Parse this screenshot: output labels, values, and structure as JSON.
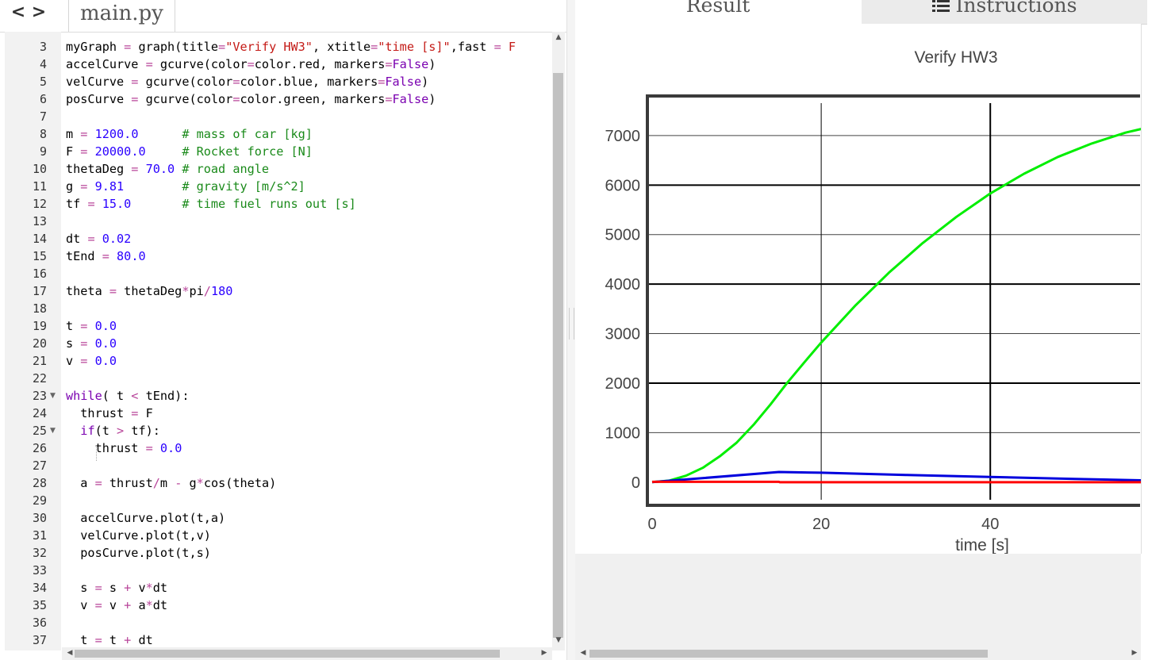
{
  "editor": {
    "filename": "main.py",
    "nav_back": "<",
    "nav_forward": ">",
    "lines": [
      {
        "no": "3",
        "fold": false,
        "html": "myGraph <span class='o'>=</span> graph(title<span class='o'>=</span><span class='s'>\"Verify HW3\"</span>, xtitle<span class='o'>=</span><span class='s'>\"time [s]\"</span>,fast <span class='o'>=</span> <span class='s'>F</span>"
      },
      {
        "no": "4",
        "fold": false,
        "html": "accelCurve <span class='o'>=</span> gcurve(color<span class='o'>=</span>color.red, markers<span class='o'>=</span><span class='k'>False</span>)"
      },
      {
        "no": "5",
        "fold": false,
        "html": "velCurve <span class='o'>=</span> gcurve(color<span class='o'>=</span>color.blue, markers<span class='o'>=</span><span class='k'>False</span>)"
      },
      {
        "no": "6",
        "fold": false,
        "html": "posCurve <span class='o'>=</span> gcurve(color<span class='o'>=</span>color.green, markers<span class='o'>=</span><span class='k'>False</span>)"
      },
      {
        "no": "7",
        "fold": false,
        "html": ""
      },
      {
        "no": "8",
        "fold": false,
        "html": "m <span class='o'>=</span> <span class='n'>1200.0</span>      <span class='c'># mass of car [kg]</span>"
      },
      {
        "no": "9",
        "fold": false,
        "html": "F <span class='o'>=</span> <span class='n'>20000.0</span>     <span class='c'># Rocket force [N]</span>"
      },
      {
        "no": "10",
        "fold": false,
        "html": "thetaDeg <span class='o'>=</span> <span class='n'>70.0</span> <span class='c'># road angle</span>"
      },
      {
        "no": "11",
        "fold": false,
        "html": "g <span class='o'>=</span> <span class='n'>9.81</span>        <span class='c'># gravity [m/s^2]</span>"
      },
      {
        "no": "12",
        "fold": false,
        "html": "tf <span class='o'>=</span> <span class='n'>15.0</span>       <span class='c'># time fuel runs out [s]</span>"
      },
      {
        "no": "13",
        "fold": false,
        "html": ""
      },
      {
        "no": "14",
        "fold": false,
        "html": "dt <span class='o'>=</span> <span class='n'>0.02</span>"
      },
      {
        "no": "15",
        "fold": false,
        "html": "tEnd <span class='o'>=</span> <span class='n'>80.0</span>"
      },
      {
        "no": "16",
        "fold": false,
        "html": ""
      },
      {
        "no": "17",
        "fold": false,
        "html": "theta <span class='o'>=</span> thetaDeg<span class='o'>*</span>pi<span class='o'>/</span><span class='n'>180</span>"
      },
      {
        "no": "18",
        "fold": false,
        "html": ""
      },
      {
        "no": "19",
        "fold": false,
        "html": "t <span class='o'>=</span> <span class='n'>0.0</span>"
      },
      {
        "no": "20",
        "fold": false,
        "html": "s <span class='o'>=</span> <span class='n'>0.0</span>"
      },
      {
        "no": "21",
        "fold": false,
        "html": "v <span class='o'>=</span> <span class='n'>0.0</span>"
      },
      {
        "no": "22",
        "fold": false,
        "html": ""
      },
      {
        "no": "23",
        "fold": true,
        "html": "<span class='k'>while</span>( t <span class='o'>&lt;</span> tEnd):"
      },
      {
        "no": "24",
        "fold": false,
        "html": "  thrust <span class='o'>=</span> F"
      },
      {
        "no": "25",
        "fold": true,
        "html": "  <span class='k'>if</span>(t <span class='o'>&gt;</span> tf):"
      },
      {
        "no": "26",
        "fold": false,
        "html": "    thrust <span class='o'>=</span> <span class='n'>0.0</span>"
      },
      {
        "no": "27",
        "fold": false,
        "html": ""
      },
      {
        "no": "28",
        "fold": false,
        "html": "  a <span class='o'>=</span> thrust<span class='o'>/</span>m <span class='o'>-</span> g<span class='o'>*</span>cos(theta)"
      },
      {
        "no": "29",
        "fold": false,
        "html": ""
      },
      {
        "no": "30",
        "fold": false,
        "html": "  accelCurve.plot(t,a)"
      },
      {
        "no": "31",
        "fold": false,
        "html": "  velCurve.plot(t,v)"
      },
      {
        "no": "32",
        "fold": false,
        "html": "  posCurve.plot(t,s)"
      },
      {
        "no": "33",
        "fold": false,
        "html": ""
      },
      {
        "no": "34",
        "fold": false,
        "html": "  s <span class='o'>=</span> s <span class='o'>+</span> v<span class='o'>*</span>dt"
      },
      {
        "no": "35",
        "fold": false,
        "html": "  v <span class='o'>=</span> v <span class='o'>+</span> a<span class='o'>*</span>dt"
      },
      {
        "no": "36",
        "fold": false,
        "html": ""
      },
      {
        "no": "37",
        "fold": false,
        "html": "  t <span class='o'>=</span> t <span class='o'>+</span> dt"
      }
    ]
  },
  "tabs": {
    "result": "Result",
    "instructions": "Instructions",
    "instructions_icon": "list-icon"
  },
  "colors": {
    "accel": "#ff0000",
    "vel": "#0000dd",
    "pos": "#00ee00",
    "keyword": "#7a00b0",
    "string": "#c41a16",
    "number": "#2a00ff",
    "comment": "#1a8a1a"
  },
  "chart_data": {
    "type": "line",
    "title": "Verify HW3",
    "xlabel": "time [s]",
    "ylabel": "",
    "xlim": [
      0,
      59.5
    ],
    "ylim": [
      -420,
      7800
    ],
    "x_ticks": [
      0,
      20,
      40,
      60
    ],
    "x_tick_labels": [
      "0",
      "20",
      "40",
      "("
    ],
    "y_ticks": [
      0,
      1000,
      2000,
      3000,
      4000,
      5000,
      6000,
      7000
    ],
    "y_tick_labels": [
      "0",
      "1000",
      "2000",
      "3000",
      "4000",
      "5000",
      "6000",
      "7000"
    ],
    "grid": true,
    "series": [
      {
        "color": "#00ee00",
        "x": [
          0,
          2,
          4,
          6,
          8,
          10,
          12,
          14,
          16,
          18,
          20,
          24,
          28,
          32,
          36,
          40,
          44,
          48,
          52,
          56,
          59.5
        ],
        "y": [
          0,
          30,
          130,
          290,
          520,
          800,
          1160,
          1570,
          2010,
          2420,
          2820,
          3560,
          4230,
          4830,
          5360,
          5830,
          6230,
          6570,
          6840,
          7060,
          7200
        ]
      },
      {
        "color": "#0000dd",
        "x": [
          0,
          15,
          20,
          30,
          40,
          50,
          59.5
        ],
        "y": [
          0,
          205,
          190,
          145,
          105,
          65,
          30
        ]
      },
      {
        "color": "#ff0000",
        "x": [
          0,
          15,
          15.1,
          59.5
        ],
        "y": [
          7,
          7,
          -1,
          -1
        ]
      }
    ]
  }
}
